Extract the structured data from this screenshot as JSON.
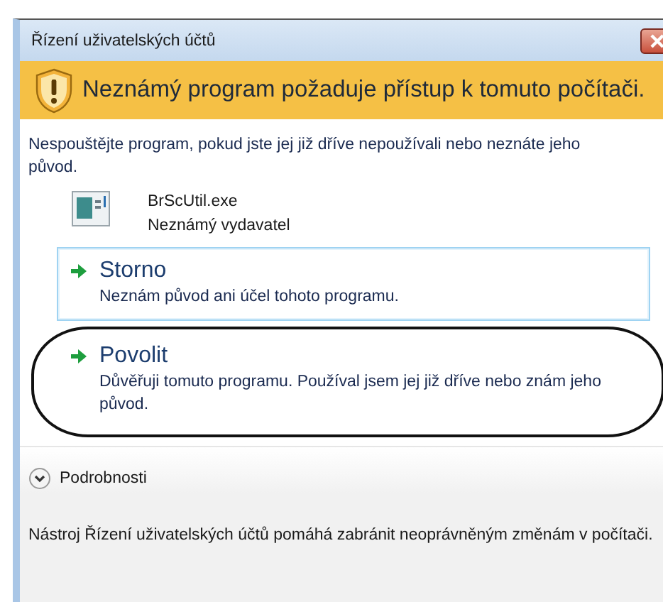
{
  "window": {
    "title": "Řízení uživatelských účtů"
  },
  "banner": {
    "text": "Neznámý program požaduje přístup k tomuto počítači."
  },
  "warning": "Nespouštějte program, pokud jste jej již dříve nepoužívali nebo neznáte jeho původ.",
  "program": {
    "name": "BrScUtil.exe",
    "publisher": "Neznámý vydavatel"
  },
  "options": [
    {
      "title": "Storno",
      "description": "Neznám původ ani účel tohoto programu.",
      "highlighted": true,
      "circled": false
    },
    {
      "title": "Povolit",
      "description": "Důvěřuji tomuto programu. Používal jsem jej již dříve nebo znám jeho původ.",
      "highlighted": false,
      "circled": true
    }
  ],
  "details": {
    "label": "Podrobnosti",
    "expanded": false
  },
  "footer": "Nástroj Řízení uživatelských účtů pomáhá zabránit neoprávněným změnám v počítači."
}
